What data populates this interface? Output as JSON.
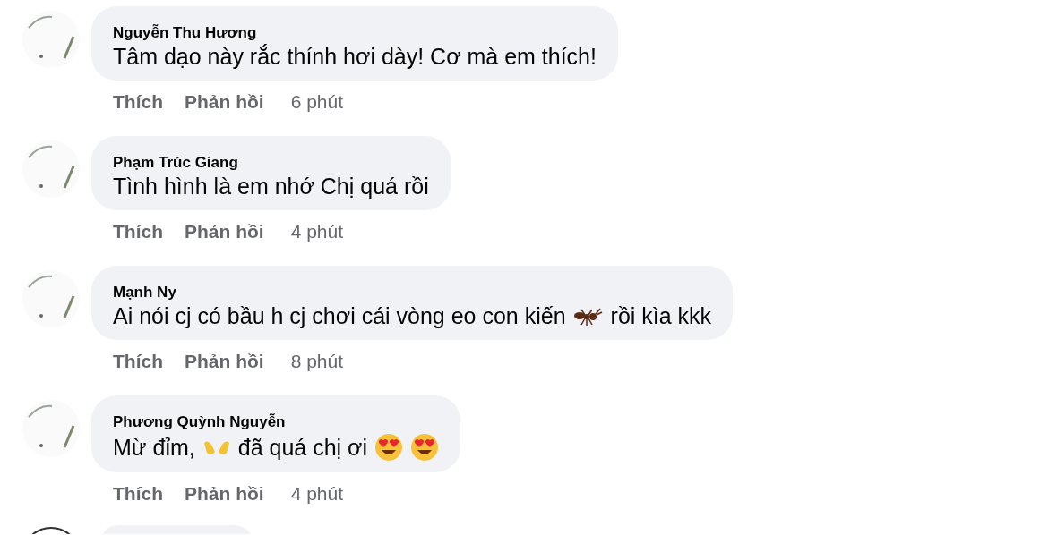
{
  "comments": [
    {
      "author": "Nguyễn Thu Hương",
      "message": [
        {
          "kind": "text",
          "text": "Tâm dạo này rắc thính hơi dày! Cơ mà em thích!"
        }
      ],
      "actions": [
        "Thích",
        "Phản hồi"
      ],
      "time": "6 phút"
    },
    {
      "author": "Phạm Trúc Giang",
      "message": [
        {
          "kind": "text",
          "text": "Tình hình là em nhớ Chị quá rồi"
        }
      ],
      "actions": [
        "Thích",
        "Phản hồi"
      ],
      "time": "4 phút"
    },
    {
      "author": "Mạnh Ny",
      "message": [
        {
          "kind": "text",
          "text": "Ai nói cj có bầu h cj chơi cái vòng eo con kiến"
        },
        {
          "kind": "ant"
        },
        {
          "kind": "text",
          "text": "rồi kìa kkk"
        }
      ],
      "actions": [
        "Thích",
        "Phản hồi"
      ],
      "time": "8 phút"
    },
    {
      "author": "Phương Quỳnh Nguyễn",
      "message": [
        {
          "kind": "text",
          "text": "Mừ đỉm,"
        },
        {
          "kind": "hands"
        },
        {
          "kind": "text",
          "text": "đã quá chị ơi"
        },
        {
          "kind": "hearteyes"
        },
        {
          "kind": "hearteyes"
        }
      ],
      "actions": [
        "Thích",
        "Phản hồi"
      ],
      "time": "4 phút"
    }
  ]
}
